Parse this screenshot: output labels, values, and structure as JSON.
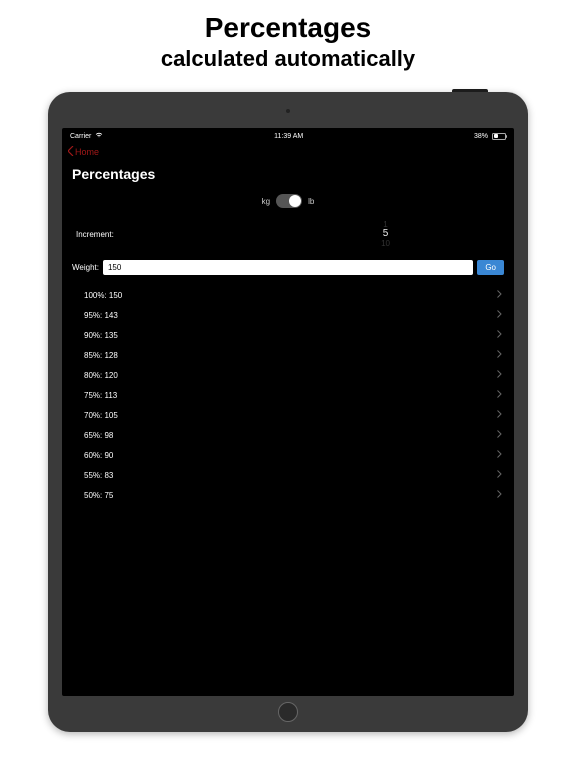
{
  "marketing": {
    "title": "Percentages",
    "subtitle": "calculated automatically"
  },
  "statusBar": {
    "carrier": "Carrier",
    "time": "11:39 AM",
    "batteryPct": "38%"
  },
  "nav": {
    "backLabel": "Home"
  },
  "page": {
    "title": "Percentages"
  },
  "unitToggle": {
    "left": "kg",
    "right": "lb",
    "state": "lb"
  },
  "increment": {
    "label": "Increment:",
    "optionAbove": "1",
    "selected": "5",
    "optionBelow": "10"
  },
  "weight": {
    "label": "Weight:",
    "value": "150",
    "goLabel": "Go"
  },
  "results": [
    {
      "text": "100%: 150"
    },
    {
      "text": "95%: 143"
    },
    {
      "text": "90%: 135"
    },
    {
      "text": "85%: 128"
    },
    {
      "text": "80%: 120"
    },
    {
      "text": "75%: 113"
    },
    {
      "text": "70%: 105"
    },
    {
      "text": "65%: 98"
    },
    {
      "text": "60%: 90"
    },
    {
      "text": "55%: 83"
    },
    {
      "text": "50%: 75"
    }
  ]
}
